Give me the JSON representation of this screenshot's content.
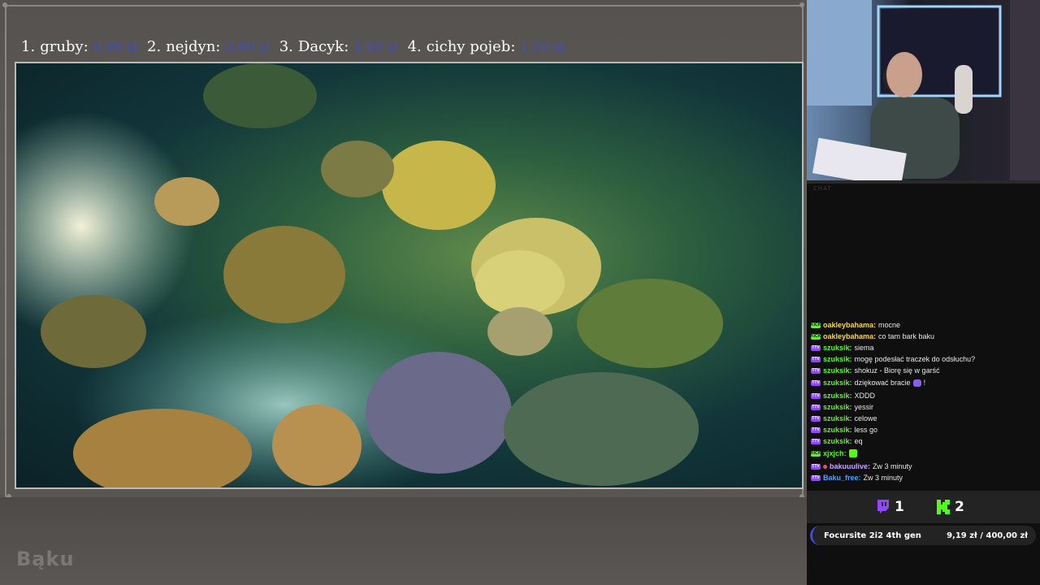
{
  "donors": [
    {
      "rank": "1.",
      "name": "gruby:",
      "amount": "6,00 zł"
    },
    {
      "rank": "2.",
      "name": "nejdyn:",
      "amount": "2,00 zł"
    },
    {
      "rank": "3.",
      "name": "Dacyk:",
      "amount": "1,50 zł"
    },
    {
      "rank": "4.",
      "name": "cichy pojeb:",
      "amount": "1,00 zł"
    }
  ],
  "brand_text": "Bąku",
  "chat_label": "CHAT",
  "chat": [
    {
      "platform": "KICK",
      "user": "oakleybahama:",
      "text": "mocne",
      "color": "#f5d84a"
    },
    {
      "platform": "KICK",
      "user": "oakleybahama:",
      "text": "co tam bark baku",
      "color": "#f5d84a"
    },
    {
      "platform": "TTV",
      "user": "szuksik:",
      "text": "siema",
      "color": "#53fc18"
    },
    {
      "platform": "TTV",
      "user": "szuksik:",
      "text": "mogę podesłać traczek do odsłuchu?",
      "color": "#53fc18"
    },
    {
      "platform": "TTV",
      "user": "szuksik:",
      "text": "shokuz - Biorę się w garść",
      "color": "#53fc18"
    },
    {
      "platform": "TTV",
      "user": "szuksik:",
      "text": "dziękować bracie",
      "suffix": "!",
      "color": "#53fc18"
    },
    {
      "platform": "TTV",
      "user": "szuksik:",
      "text": "XDDD",
      "color": "#53fc18"
    },
    {
      "platform": "TTV",
      "user": "szuksik:",
      "text": "yessir",
      "color": "#53fc18"
    },
    {
      "platform": "TTV",
      "user": "szuksik:",
      "text": "celowe",
      "color": "#53fc18"
    },
    {
      "platform": "TTV",
      "user": "szuksik:",
      "text": "less go",
      "color": "#53fc18"
    },
    {
      "platform": "TTV",
      "user": "szuksik:",
      "text": "eq",
      "color": "#53fc18"
    },
    {
      "platform": "KICK",
      "user": "xjxjch:",
      "text": "",
      "color": "#53fc18"
    },
    {
      "platform": "TTV",
      "user": "bakuuulive:",
      "text": "Zw 3 minuty",
      "color": "#c9a6ff"
    },
    {
      "platform": "TTV",
      "user": "Baku_free:",
      "text": "Zw 3 minuty",
      "color": "#4aa3ff"
    }
  ],
  "viewer_counts": {
    "twitch": "1",
    "kick": "2"
  },
  "goal": {
    "title": "Focursite 2i2 4th gen",
    "progress": "9,19 zł",
    "separator": "/",
    "target": "400,00 zł"
  },
  "colors": {
    "twitch": "#9146ff",
    "kick": "#53fc18",
    "accent": "#3b4fd9"
  }
}
